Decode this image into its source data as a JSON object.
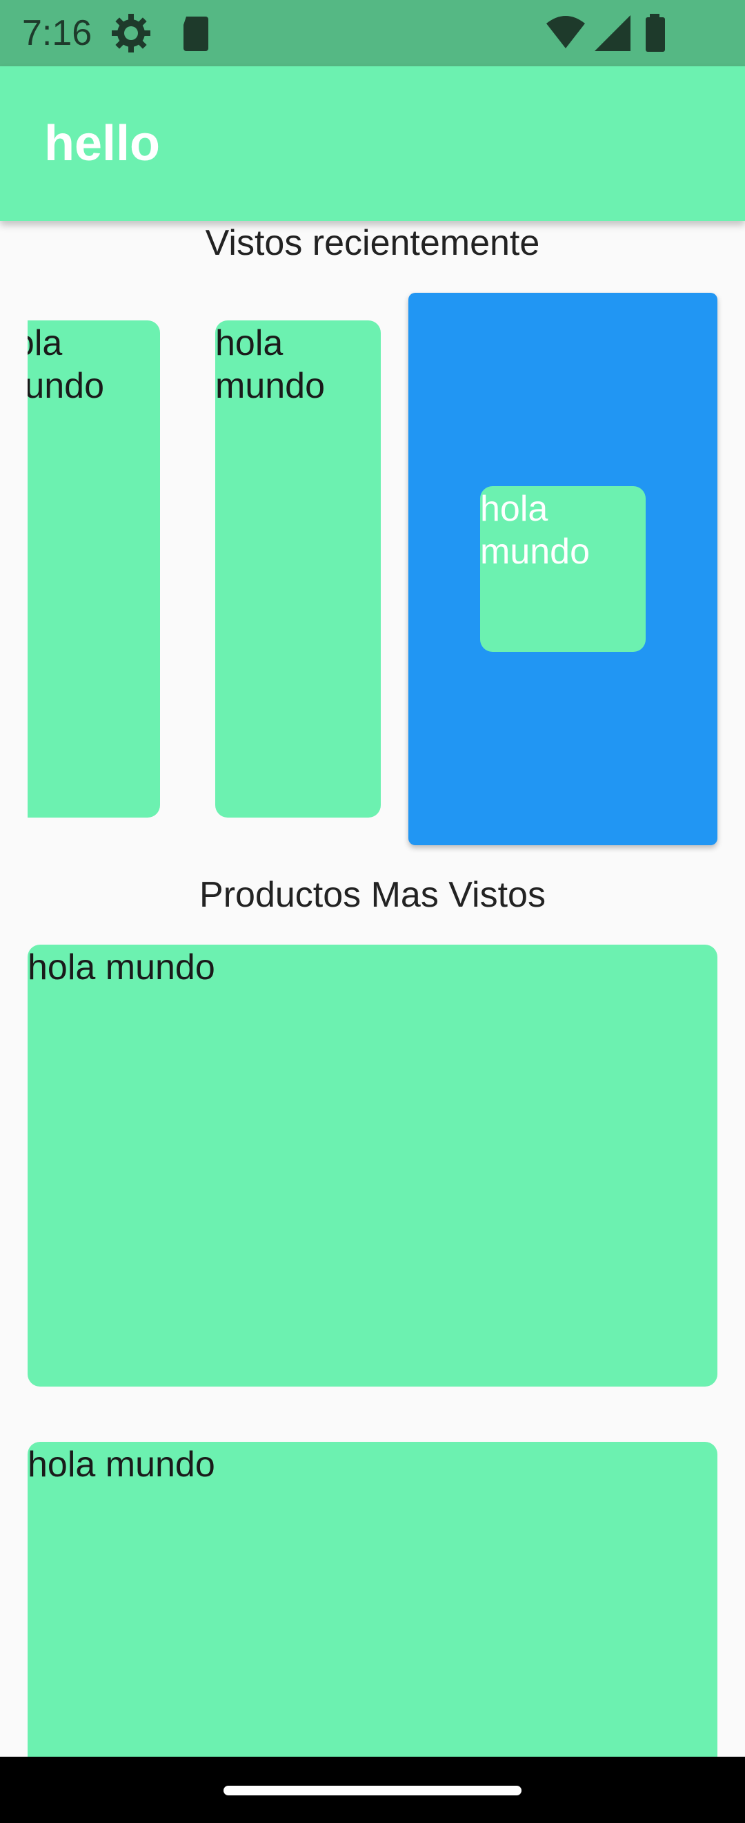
{
  "status_bar": {
    "time": "7:16",
    "icons": [
      "gear-icon",
      "sd-card-icon",
      "wifi-icon",
      "signal-icon",
      "battery-icon"
    ]
  },
  "app_bar": {
    "title": "hello"
  },
  "recent_section": {
    "title": "Vistos recientemente",
    "cards": [
      {
        "text": "hola mundo"
      },
      {
        "text": "hola mundo"
      },
      {
        "text": "hola mundo",
        "selected": true
      }
    ]
  },
  "most_viewed_section": {
    "title": "Productos Mas Vistos",
    "cards": [
      {
        "text": "hola mundo"
      },
      {
        "text": "hola mundo"
      }
    ]
  },
  "colors": {
    "card": "#6cf1b0",
    "app_bar": "#6cf1b0",
    "status_bar": "#55b884",
    "selected_frame": "#2196f3",
    "background": "#fafafa"
  }
}
